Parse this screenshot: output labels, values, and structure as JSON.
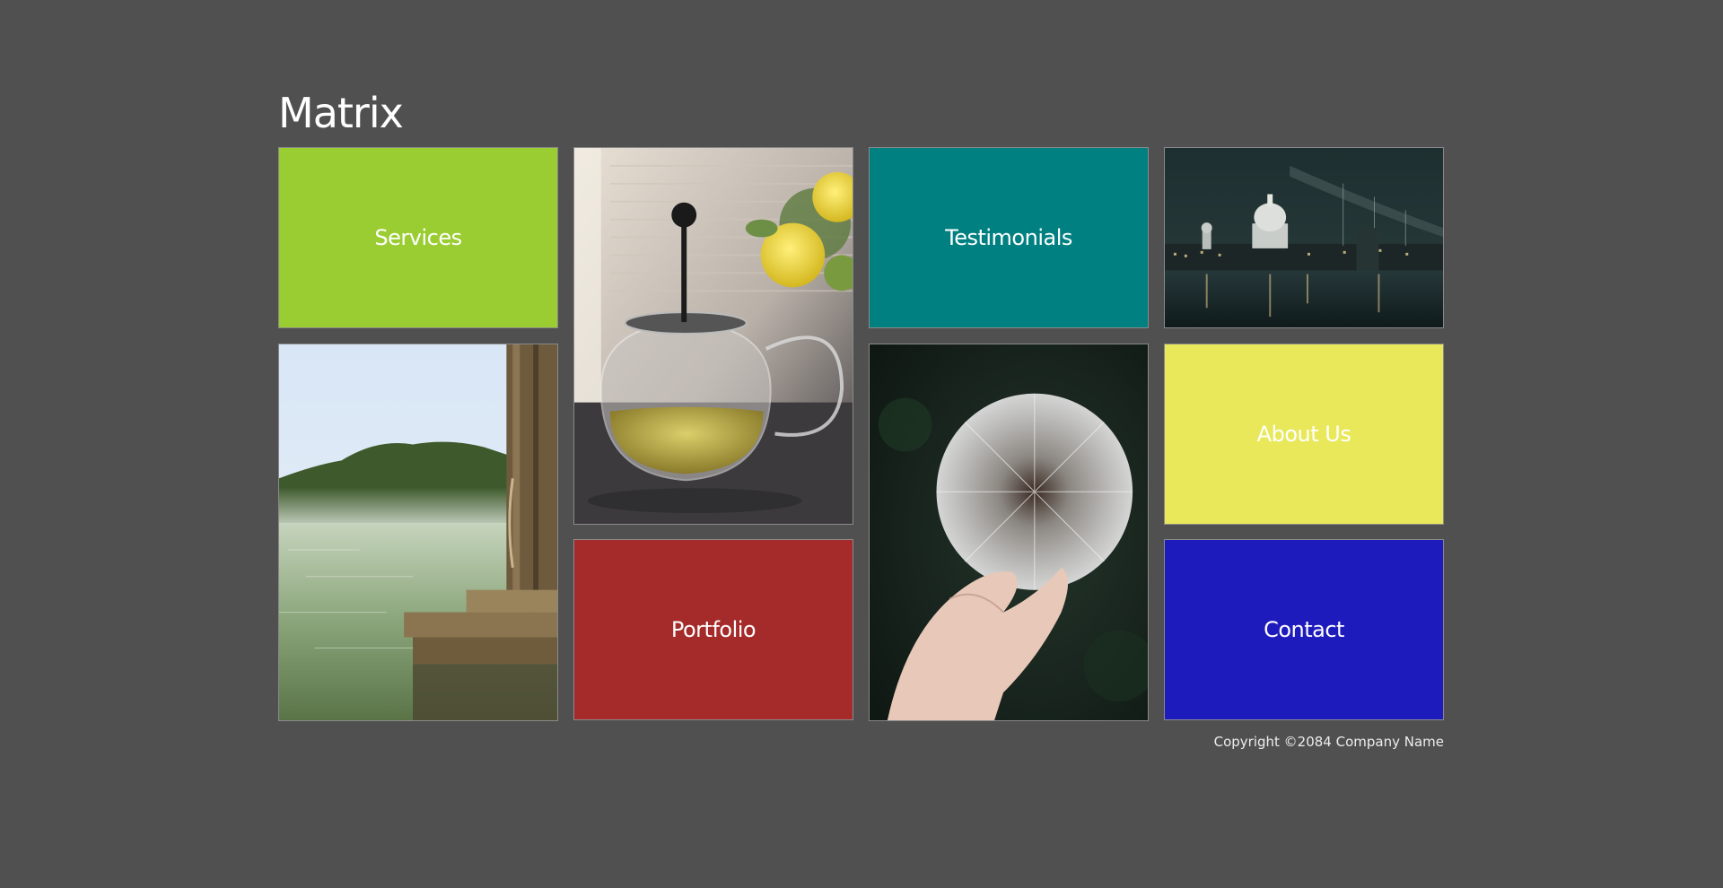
{
  "site": {
    "title": "Matrix"
  },
  "tiles": {
    "services": {
      "label": "Services",
      "color": "#9acd32"
    },
    "testimonials": {
      "label": "Testimonials",
      "color": "#008080"
    },
    "about": {
      "label": "About Us",
      "color": "#e8e85a"
    },
    "portfolio": {
      "label": "Portfolio",
      "color": "#a52a2a"
    },
    "contact": {
      "label": "Contact",
      "color": "#1e1bbd"
    }
  },
  "photos": [
    {
      "icon": "tea-press-photo"
    },
    {
      "icon": "city-night-bridge-photo"
    },
    {
      "icon": "misty-lake-dock-photo"
    },
    {
      "icon": "dandelion-hand-photo"
    }
  ],
  "footer": {
    "copyright": "Copyright ©2084 Company Name"
  },
  "colors": {
    "background": "#505050",
    "tile_border": "#8a8a8a",
    "text": "#ffffff"
  }
}
